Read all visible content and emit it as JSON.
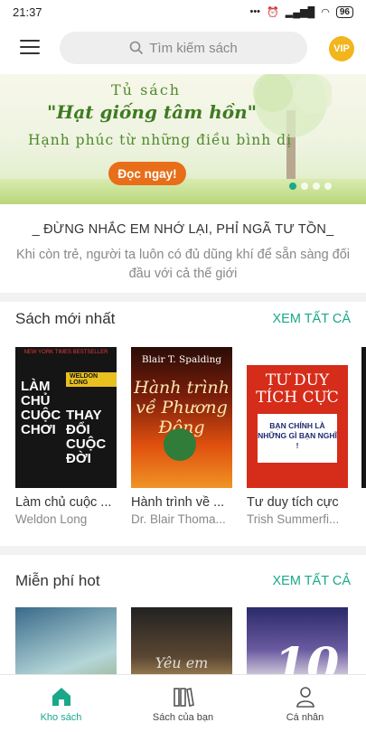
{
  "status": {
    "time": "21:37",
    "battery": "96"
  },
  "header": {
    "search_placeholder": "Tìm kiếm sách",
    "vip_label": "VIP"
  },
  "banner": {
    "line1": "Tủ sách",
    "line2": "\"Hạt giống tâm hồn\"",
    "line3": "Hạnh phúc từ những điều bình dị",
    "cta": "Đọc ngay!"
  },
  "quote": {
    "title": "_ ĐỪNG NHẮC EM NHỚ LẠI, PHỈ NGÃ TƯ TỒN_",
    "text": "Khi còn trẻ, người ta luôn có đủ dũng khí để sẵn sàng đối đầu với cả thế giới"
  },
  "newest": {
    "title": "Sách mới nhất",
    "see_all": "XEM TẤT CẢ",
    "books": [
      {
        "title": "Làm chủ cuộc ...",
        "author": "Weldon Long",
        "cover": {
          "top": "NEW YORK TIMES BESTSELLER",
          "left": "LÀM CHỦ CUỘC CHƠI",
          "badge": "WELDON LONG",
          "right": "THAY ĐỔI CUỘC ĐỜI"
        }
      },
      {
        "title": "Hành trình về ...",
        "author": "Dr. Blair Thoma...",
        "cover": {
          "author": "Blair T. Spalding",
          "name": "Hành trình về Phương Đông"
        }
      },
      {
        "title": "Tư duy tích cực",
        "author": "Trish Summerfi...",
        "cover": {
          "name": "TƯ DUY TÍCH CỰC",
          "box": "BẠN CHÍNH LÀ NHỮNG GÌ BẠN NGHĨ !"
        }
      }
    ]
  },
  "free_hot": {
    "title": "Miễn phí hot",
    "see_all": "XEM TẤT CẢ",
    "books": [
      {
        "cover": {}
      },
      {
        "cover": {
          "script": "Yêu em"
        }
      },
      {
        "cover": {
          "number": "10"
        }
      }
    ]
  },
  "tabs": [
    {
      "label": "Kho sách",
      "icon": "home-icon"
    },
    {
      "label": "Sách của bạn",
      "icon": "books-icon"
    },
    {
      "label": "Cá nhân",
      "icon": "person-icon"
    }
  ],
  "colors": {
    "accent": "#1aa889",
    "vip": "#f2b51b",
    "cta": "#e86e1a"
  }
}
